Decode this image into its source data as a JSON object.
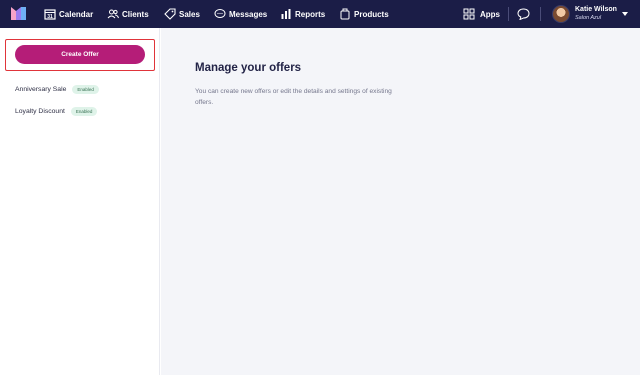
{
  "nav": {
    "items": [
      {
        "label": "Calendar",
        "icon": "calendar-icon"
      },
      {
        "label": "Clients",
        "icon": "clients-icon"
      },
      {
        "label": "Sales",
        "icon": "sales-tag-icon"
      },
      {
        "label": "Messages",
        "icon": "messages-icon"
      },
      {
        "label": "Reports",
        "icon": "reports-chart-icon"
      },
      {
        "label": "Products",
        "icon": "products-icon"
      }
    ],
    "apps_label": "Apps",
    "apps_icon": "apps-grid-icon",
    "chat_icon": "chat-bubble-icon"
  },
  "user": {
    "name": "Katie Wilson",
    "salon": "Salon Azul"
  },
  "sidebar": {
    "create_label": "Create Offer",
    "offers": [
      {
        "name": "Anniversary Sale",
        "status": "Enabled"
      },
      {
        "name": "Loyalty Discount",
        "status": "Enabled"
      }
    ]
  },
  "main": {
    "title": "Manage your offers",
    "description": "You can create new offers or edit the details and settings of existing offers."
  },
  "colors": {
    "nav_bg": "#1b1d47",
    "primary_button": "#b51d78",
    "highlight": "#e0343a",
    "badge_bg": "#dff3e9",
    "main_bg": "#f4f5f9"
  }
}
